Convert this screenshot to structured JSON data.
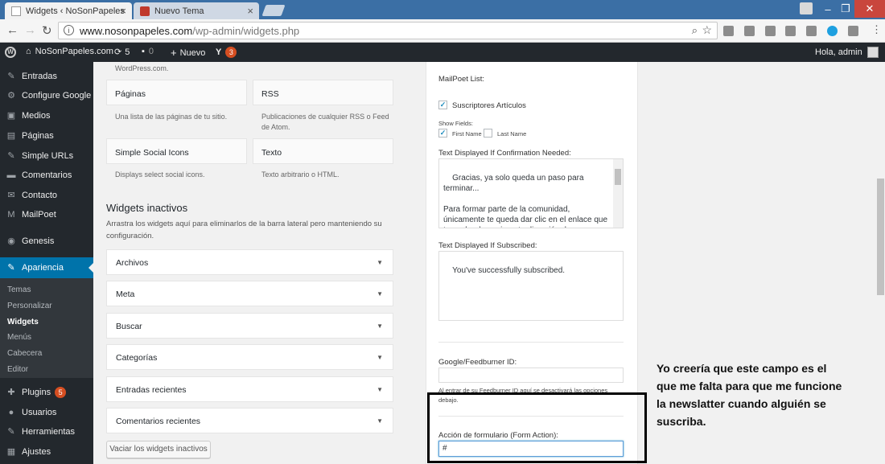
{
  "browser": {
    "tabs": [
      {
        "title": "Widgets ‹ NoSonPapeles",
        "active": true
      },
      {
        "title": "Nuevo Tema",
        "active": false
      }
    ],
    "url_host": "www.nosonpapeles.com",
    "url_path": "/wp-admin/widgets.php",
    "window_controls": [
      "minimize-icon",
      "restore-icon",
      "close-icon"
    ],
    "extension_icons": [
      "puzzle-icon",
      "info-icon",
      "a-icon",
      "image-icon",
      "cloud-icon",
      "skype-icon",
      "pdf-icon"
    ]
  },
  "adminbar": {
    "site_name": "NoSonPapeles.com",
    "updates_count": "5",
    "comments_count": "0",
    "new_label": "Nuevo",
    "yoast_count": "3",
    "greeting": "Hola, admin"
  },
  "sidebar": {
    "items": [
      {
        "label": "Entradas",
        "icon": "pin-icon"
      },
      {
        "label": "Configure Google",
        "icon": "gear-icon"
      },
      {
        "label": "Medios",
        "icon": "media-icon"
      },
      {
        "label": "Páginas",
        "icon": "page-icon"
      },
      {
        "label": "Simple URLs",
        "icon": "pin-icon"
      },
      {
        "label": "Comentarios",
        "icon": "comment-icon"
      },
      {
        "label": "Contacto",
        "icon": "mail-icon"
      },
      {
        "label": "MailPoet",
        "icon": "mailpoet-icon"
      },
      {
        "label": "Genesis",
        "icon": "genesis-icon"
      },
      {
        "label": "Apariencia",
        "icon": "brush-icon",
        "current": true
      }
    ],
    "submenu": [
      "Temas",
      "Personalizar",
      "Widgets",
      "Menús",
      "Cabecera",
      "Editor"
    ],
    "lower_items": [
      {
        "label": "Plugins",
        "icon": "plug-icon",
        "badge": "5"
      },
      {
        "label": "Usuarios",
        "icon": "user-icon"
      },
      {
        "label": "Herramientas",
        "icon": "wrench-icon"
      },
      {
        "label": "Ajustes",
        "icon": "settings-icon"
      }
    ]
  },
  "available_widgets": {
    "top_note": "WordPress.com.",
    "items": [
      {
        "title": "Páginas",
        "desc": "Una lista de las páginas de tu sitio."
      },
      {
        "title": "RSS",
        "desc": "Publicaciones de cualquier RSS o Feed de Atom."
      },
      {
        "title": "Simple Social Icons",
        "desc": "Displays select social icons."
      },
      {
        "title": "Texto",
        "desc": "Texto arbitrario o HTML."
      }
    ]
  },
  "inactive_widgets": {
    "title": "Widgets inactivos",
    "desc": "Arrastra los widgets aquí para eliminarlos de la barra lateral pero manteniendo su configuración.",
    "items": [
      "Archivos",
      "Meta",
      "Buscar",
      "Categorías",
      "Entradas recientes",
      "Comentarios recientes"
    ],
    "clear_button": "Vaciar los widgets inactivos"
  },
  "form": {
    "list_label": "MailPoet List:",
    "list_option": "Suscriptores Artículos",
    "show_fields_label": "Show Fields:",
    "first_name": "First Name",
    "last_name": "Last Name",
    "confirm_label": "Text Displayed If Confirmation Needed:",
    "confirm_text": "Gracias, ya solo queda un paso para terminar...\n\nPara formar parte de la comunidad, únicamente te queda dar clic en el enlace que te acabo de enviar a tu dirección de correo",
    "subscribed_label": "Text Displayed If Subscribed:",
    "subscribed_text": "You've successfully subscribed.",
    "feedburner_label": "Google/Feedburner ID:",
    "feedburner_value": "",
    "feedburner_note": "Al entrar de su Feedburner ID aquí se desactivará las opciones debajo.",
    "action_label": "Acción de formulario (Form Action):",
    "action_value": "#"
  },
  "annotation": "Yo creería que este campo es el que me falta para que me funcione la newslatter cuando alguién se suscriba."
}
